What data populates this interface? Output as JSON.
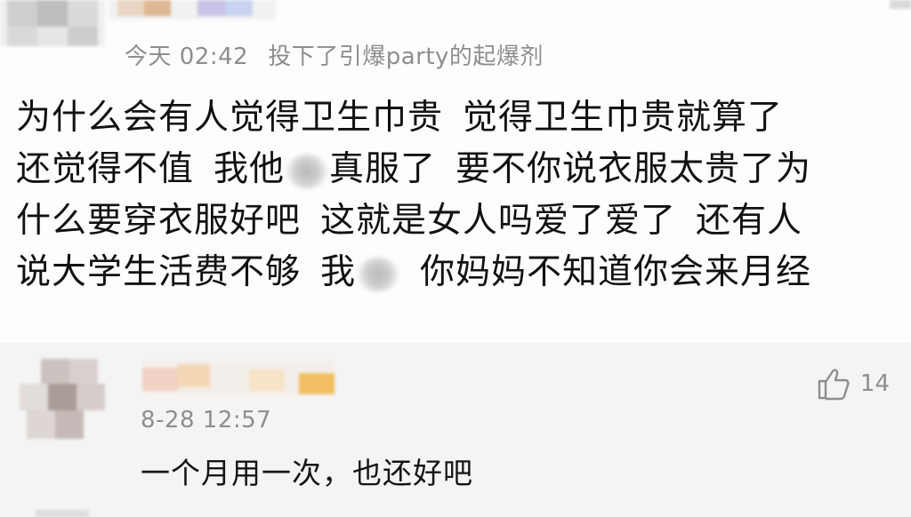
{
  "post": {
    "time": "今天 02:42",
    "source": "投下了引爆party的起爆剂",
    "lines": [
      {
        "a": "为什么会有人觉得卫生巾贵",
        "b": "觉得卫生巾贵就算了"
      },
      {
        "a": "还觉得不值",
        "b1": "我他",
        "b2": "真服了",
        "c": "要不你说衣服太贵了为"
      },
      {
        "a": "什么要穿衣服好吧",
        "b": "这就是女人吗爱了爱了",
        "c": "还有人"
      },
      {
        "a": "说大学生活费不够",
        "b1": "我",
        "c": "你妈妈不知道你会来月经"
      }
    ]
  },
  "comment": {
    "time": "8-28 12:57",
    "text": "一个月用一次，也还好吧",
    "likes": "14"
  },
  "colors": {
    "meta": "#8e8e8e",
    "comment_bg": "#f4f4f4",
    "text": "#111111"
  },
  "icons": {
    "like": "thumbs-up-icon"
  }
}
